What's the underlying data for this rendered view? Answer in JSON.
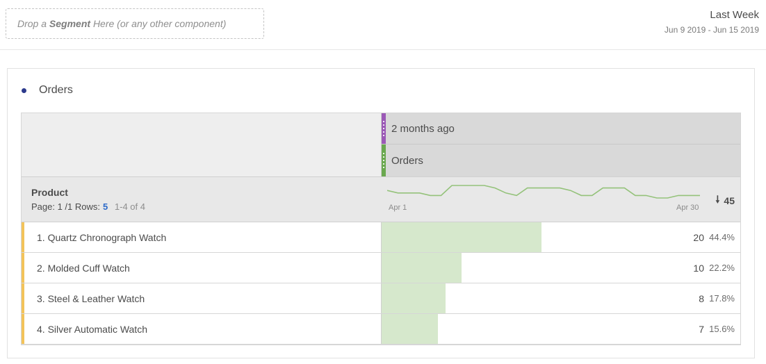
{
  "dropzone": {
    "prefix": "Drop a",
    "segment_word": "Segment",
    "suffix": "Here (or any other component)"
  },
  "date_range": {
    "label": "Last Week",
    "range": "Jun 9 2019 - Jun 15 2019"
  },
  "panel": {
    "title": "Orders",
    "dot_color": "#2c3a8c"
  },
  "table": {
    "segment_header": "2 months ago",
    "metric_header": "Orders",
    "dimension": {
      "name": "Product",
      "page_label": "Page: 1 /1",
      "rows_label": "Rows:",
      "rows_value": "5",
      "range": "1-4 of 4"
    },
    "sparkline": {
      "start_label": "Apr 1",
      "end_label": "Apr 30",
      "values": [
        3,
        2,
        2,
        2,
        1,
        1,
        5,
        5,
        5,
        5,
        4,
        2,
        1,
        4,
        4,
        4,
        4,
        3,
        1,
        1,
        4,
        4,
        4,
        1,
        1,
        0,
        0,
        1,
        1,
        1
      ],
      "color": "#94c27a"
    },
    "total": "45",
    "rows": [
      {
        "label": "1. Quartz Chronograph Watch",
        "value": "20",
        "pct": "44.4%",
        "share": 0.444
      },
      {
        "label": "2. Molded Cuff Watch",
        "value": "10",
        "pct": "22.2%",
        "share": 0.222
      },
      {
        "label": "3. Steel & Leather Watch",
        "value": "8",
        "pct": "17.8%",
        "share": 0.178
      },
      {
        "label": "4. Silver Automatic Watch",
        "value": "7",
        "pct": "15.6%",
        "share": 0.156
      }
    ]
  }
}
